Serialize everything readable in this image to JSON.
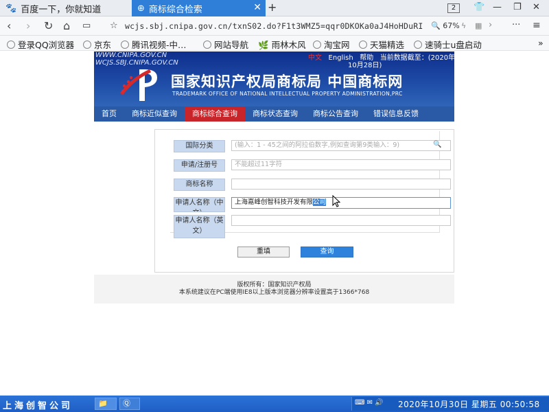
{
  "browser": {
    "tabs": [
      {
        "title": "百度一下，你就知道"
      },
      {
        "title": "商标综合检索"
      }
    ],
    "tab_count": "2",
    "url": "wcjs.sbj.cnipa.gov.cn/txnS02.do?F1t3WMZ5=qqr0DKOKa0aJ4HoHDuRI",
    "zoom": "67%",
    "more": "···"
  },
  "bookmarks": [
    {
      "label": "登录QQ浏览器"
    },
    {
      "label": "京东"
    },
    {
      "label": "腾讯视频-中…"
    },
    {
      "label": "网站导航"
    },
    {
      "label": "雨林木风"
    },
    {
      "label": "淘宝网"
    },
    {
      "label": "天猫精选"
    },
    {
      "label": "速骑士u盘启动"
    }
  ],
  "site": {
    "url_line1": "WWW.CNIPA.GOV.CN",
    "url_line2": "WCJS.SBJ.CNIPA.GOV.CN",
    "lang_cn": "中文",
    "lang_en": "English",
    "help": "帮助",
    "date_prefix": "当前数据截至：(2020年",
    "date_suffix": "10月28日)",
    "title_cn": "国家知识产权局商标局 中国商标网",
    "title_en": "TRADEMARK OFFICE OF NATIONAL INTELLECTUAL PROPERTY ADMINISTRATION,PRC",
    "menu": [
      {
        "label": "首页"
      },
      {
        "label": "商标近似查询"
      },
      {
        "label": "商标综合查询"
      },
      {
        "label": "商标状态查询"
      },
      {
        "label": "商标公告查询"
      },
      {
        "label": "错误信息反馈"
      }
    ]
  },
  "form": {
    "class": {
      "label": "国际分类",
      "placeholder": "(输入：1 - 45之间的阿拉伯数字,例如查询第9类输入：9)"
    },
    "reg_no": {
      "label": "申请/注册号",
      "placeholder": "不能超过11字符"
    },
    "name": {
      "label": "商标名称",
      "value": ""
    },
    "applicant_cn": {
      "label": "申请人名称（中文）",
      "value_plain": "上海嘉峰创智科技开发有限",
      "value_selected": "公司"
    },
    "applicant_en": {
      "label": "申请人名称（英文）",
      "value": ""
    },
    "reset": "重填",
    "query": "查询"
  },
  "footer": {
    "line1": "版权所有：国家知识产权局",
    "line2": "本系统建议在PC端使用IE8以上版本浏览器分辨率设置高于1366*768"
  },
  "taskbar": {
    "start": "上海创智公司",
    "clock": "2020年10月30日  星期五  00:50:58"
  },
  "colors": {
    "tab_active": "#2f7fd8",
    "nav_active": "#c8252a",
    "banner": "#1f4ea8",
    "taskbar": "#2b73d8"
  }
}
